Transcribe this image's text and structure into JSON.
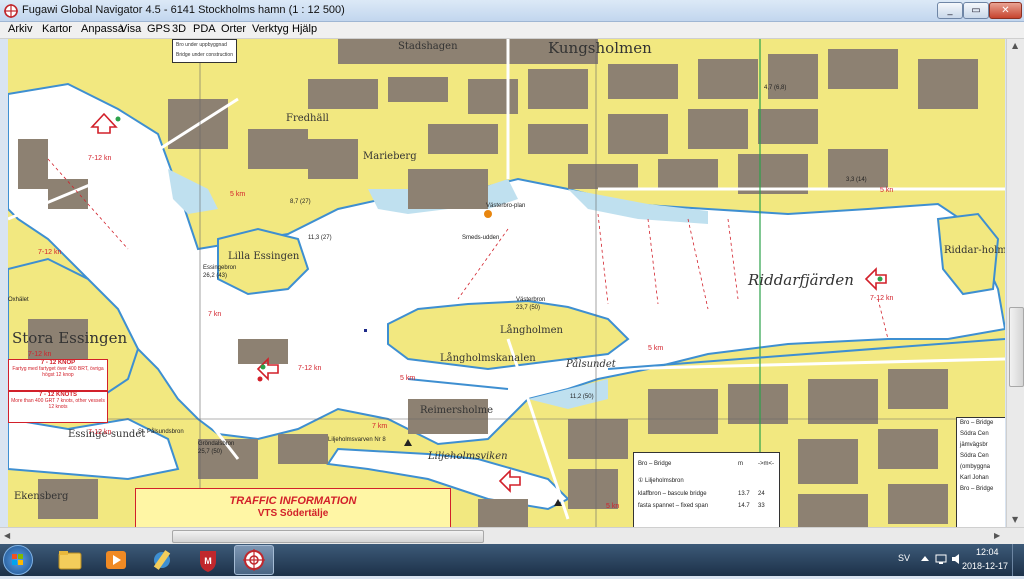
{
  "window": {
    "title": "Fugawi Global Navigator 4.5 - 6141 Stockholms hamn  (1 : 12 500)",
    "controls": {
      "minimize": "_",
      "maximize": "▭",
      "close": "✕"
    }
  },
  "menu": [
    "Arkiv",
    "Kartor",
    "Anpassa",
    "Visa",
    "GPS",
    "3D",
    "PDA",
    "Orter",
    "Verktyg",
    "Hjälp"
  ],
  "map": {
    "places": {
      "kungsholmen": "Kungsholmen",
      "stadshagen": "Stadshagen",
      "fredhall": "Fredhäll",
      "marieberg": "Marieberg",
      "lilla_essingen": "Lilla Essingen",
      "stora_essingen": "Stora Essingen",
      "riddarfjarden": "Riddarfjärden",
      "langholmen": "Långholmen",
      "langholmskanalen": "Långholmskanalen",
      "reimersholme": "Reimersholme",
      "liljeholmsviken": "Liljeholmsviken",
      "essingesundet": "Essinge-sundet",
      "ekensberg": "Ekensberg",
      "riddarholmen": "Riddar-holmen",
      "palsundet": "Pålsundet",
      "smedsudden": "Smeds-udden",
      "oxhalet": "Oxhälet",
      "vasterbroplan": "Västerbro-plan"
    },
    "bridges": {
      "vasterbron": "Västerbron",
      "vasterbron_clear": "23,7 (50)",
      "essingebron": "Essingebron",
      "essingebron_clear": "26,2 (43)",
      "granbacksbron": "Gröndalsbron",
      "granbacksbron_clear": "25,7 (50)",
      "pampabron": "St. Pålsundsbron",
      "marieberg_bridge_clear": "11,3 (27)",
      "fredhall_clear": "8,7 (27)",
      "langholm_clear": "11,2 (50)",
      "stadsgarden_clear": "3,3 (14)",
      "kungsbron_clear": "4,7 (6,8)"
    },
    "speeds": {
      "s1": "7-12 kn",
      "s2": "5 km",
      "s3": "7 kn",
      "s4": "7-12 kn",
      "s5": "7-12 kn",
      "s6": "5 km",
      "s7": "7 km",
      "s8": "5 km",
      "s9": "5 kn",
      "s10": "7-12 kn",
      "s11": "5 kn",
      "s12": "7-12 kn",
      "s13": "7-12 kn"
    },
    "top_legend": [
      "Bro under uppbyggnad",
      "Bridge under construction"
    ],
    "speed_box": {
      "head1": "7 - 12 KNOP",
      "text1": "Fartyg med fartyget över 400 BRT, övriga högst 12 knop",
      "head2": "7 - 12 KNOTS",
      "text2": "More than 400 GRT 7 knots, other vessels 12 knots"
    },
    "traffic": {
      "title": "TRAFFIC INFORMATION",
      "subtitle": "VTS Södertälje"
    },
    "bridge_table": {
      "title": "Bro – Bridge",
      "col1": "m",
      "col2": "->m<-",
      "rows": [
        {
          "name": "① Liljeholmsbron",
          "v1": "",
          "v2": ""
        },
        {
          "name": "klaffbron – bascule bridge",
          "v1": "13.7",
          "v2": "24"
        },
        {
          "name": "fasta spannet – fixed span",
          "v1": "14.7",
          "v2": "33"
        }
      ]
    },
    "bridge_right": {
      "title": "Bro – Bridge",
      "items": [
        "Södra Cen",
        "jämvägsbr",
        "Södra Cen",
        "(ombyggna",
        "Karl Johan",
        "Bro – Bridge"
      ]
    },
    "liljeholmsvarven": "Liljeholmsvarven Nr 8",
    "colors": {
      "land": "#f2e880",
      "urban": "#8d8172",
      "water": "#ffffff",
      "shallow": "#bfe0ef",
      "deep_blue": "#3e8fd1"
    }
  },
  "taskbar": {
    "apps": [
      "start-orb",
      "explorer",
      "media-player",
      "paint-tool",
      "mcafee",
      "fugawi"
    ],
    "language": "SV",
    "time": "12:04",
    "date": "2018-12-17"
  }
}
